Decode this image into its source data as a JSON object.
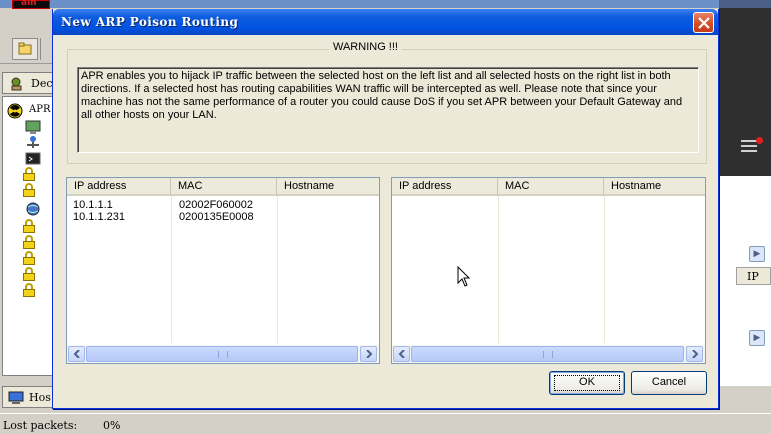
{
  "background": {
    "logo_text": "ain",
    "tab_label": "Dec",
    "tree_root_label": "APR",
    "hosts_tab_label": "Hos",
    "status": {
      "lost_packets_label": "Lost packets:",
      "lost_packets_value": "0%"
    },
    "right_column_header": "IP"
  },
  "dialog": {
    "title": "New ARP Poison Routing",
    "warning": {
      "legend": "WARNING !!!",
      "text": "APR enables you to hijack IP traffic between the selected host on the left list and all selected hosts on the right list in both directions. If a selected host has routing capabilities WAN traffic will be intercepted as well. Please note that since your machine has not the same performance of a router you could cause DoS if you set APR between your Default Gateway and all other hosts on your LAN."
    },
    "left_list": {
      "columns": [
        "IP address",
        "MAC",
        "Hostname"
      ],
      "rows": [
        {
          "ip": "10.1.1.1",
          "mac": "02002F060002",
          "hostname": ""
        },
        {
          "ip": "10.1.1.231",
          "mac": "0200135E0008",
          "hostname": ""
        }
      ]
    },
    "right_list": {
      "columns": [
        "IP address",
        "MAC",
        "Hostname"
      ],
      "rows": []
    },
    "buttons": {
      "ok": "OK",
      "cancel": "Cancel"
    }
  },
  "colors": {
    "title_bar": "#0054e3",
    "close_button": "#d24a25",
    "dialog_face": "#ece9d8",
    "list_border": "#7f9db9"
  },
  "icons": [
    "close-icon",
    "scroll-left-icon",
    "scroll-right-icon",
    "lock-icon",
    "menu-icon",
    "mouse-cursor-icon"
  ]
}
